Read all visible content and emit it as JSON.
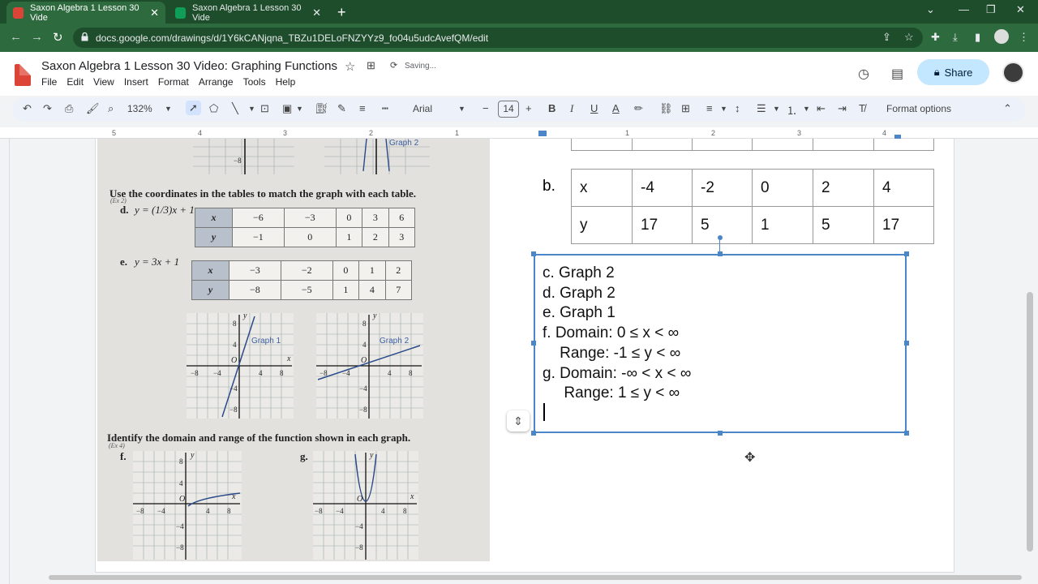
{
  "browser": {
    "tabs": [
      {
        "title": "Saxon Algebra 1 Lesson 30 Vide",
        "active": true
      },
      {
        "title": "Saxon Algebra 1 Lesson 30 Vide",
        "active": false
      }
    ],
    "url": "docs.google.com/drawings/d/1Y6kCANjqna_TBZu1DELoFNZYYz9_fo04u5udcAvefQM/edit"
  },
  "doc": {
    "title": "Saxon Algebra 1 Lesson 30 Video: Graphing Functions",
    "saving": "Saving...",
    "menu": [
      "File",
      "Edit",
      "View",
      "Insert",
      "Format",
      "Arrange",
      "Tools",
      "Help"
    ],
    "share_label": "Share"
  },
  "toolbar": {
    "zoom": "132%",
    "font": "Arial",
    "font_size": "14",
    "format_options": "Format options"
  },
  "ruler": [
    "5",
    "4",
    "3",
    "2",
    "1",
    "1",
    "2",
    "3",
    "4"
  ],
  "scan": {
    "graph2_top_label": "Graph 2",
    "instr1": "Use the coordinates in the tables to match the graph with each table.",
    "ex2": "(Ex 2)",
    "d_label": "d.",
    "d_eq": "y = (1/3)x + 1",
    "d_x": [
      "x",
      "−6",
      "−3",
      "0",
      "3",
      "6"
    ],
    "d_y": [
      "y",
      "−1",
      "0",
      "1",
      "2",
      "3"
    ],
    "e_label": "e.",
    "e_eq": "y = 3x + 1",
    "e_x": [
      "x",
      "−3",
      "−2",
      "0",
      "1",
      "2"
    ],
    "e_y": [
      "y",
      "−8",
      "−5",
      "1",
      "4",
      "7"
    ],
    "graph1_label": "Graph 1",
    "graph2_label": "Graph 2",
    "instr2": "Identify the domain and range of the function shown in each graph.",
    "ex4": "(Ex 4)",
    "f_label": "f.",
    "g_label": "g.",
    "ticks": {
      "neg8": "−8",
      "neg4": "−4",
      "pos4": "4",
      "pos8": "8",
      "origin": "O",
      "xaxis": "x",
      "yaxis": "y"
    }
  },
  "table_b": {
    "label": "b.",
    "x_row": [
      "x",
      "-4",
      "-2",
      "0",
      "2",
      "4"
    ],
    "y_row": [
      "y",
      "17",
      "5",
      "1",
      "5",
      "17"
    ]
  },
  "textbox": {
    "lines": "c. Graph 2\nd. Graph 2\ne. Graph 1\nf. Domain: 0 ≤ x < ∞\n    Range: -1 ≤ y < ∞\ng. Domain: -∞ < x < ∞\n     Range: 1 ≤ y < ∞"
  }
}
